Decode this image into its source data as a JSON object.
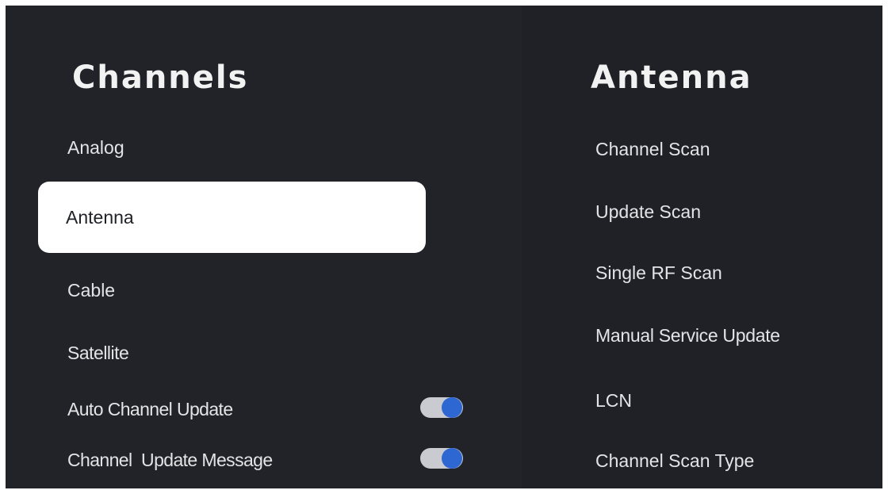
{
  "left_panel": {
    "title": "Channels",
    "items": [
      {
        "label": "Analog"
      },
      {
        "label": "Antenna",
        "selected": true
      },
      {
        "label": "Cable"
      },
      {
        "label": "Satellite"
      },
      {
        "label": "Auto Channel Update",
        "toggle": true,
        "state": "on"
      },
      {
        "label": "Channel  Update Message",
        "toggle": true,
        "state": "on"
      }
    ]
  },
  "right_panel": {
    "title": "Antenna",
    "items": [
      {
        "label": "Channel Scan"
      },
      {
        "label": "Update Scan"
      },
      {
        "label": "Single RF Scan"
      },
      {
        "label": "Manual Service Update"
      },
      {
        "label": "LCN"
      },
      {
        "label": "Channel Scan Type"
      }
    ]
  },
  "colors": {
    "background": "#212329",
    "selected_background": "#ffffff",
    "toggle_on_knob": "#2f67d2",
    "toggle_track": "#c9cbd0"
  }
}
